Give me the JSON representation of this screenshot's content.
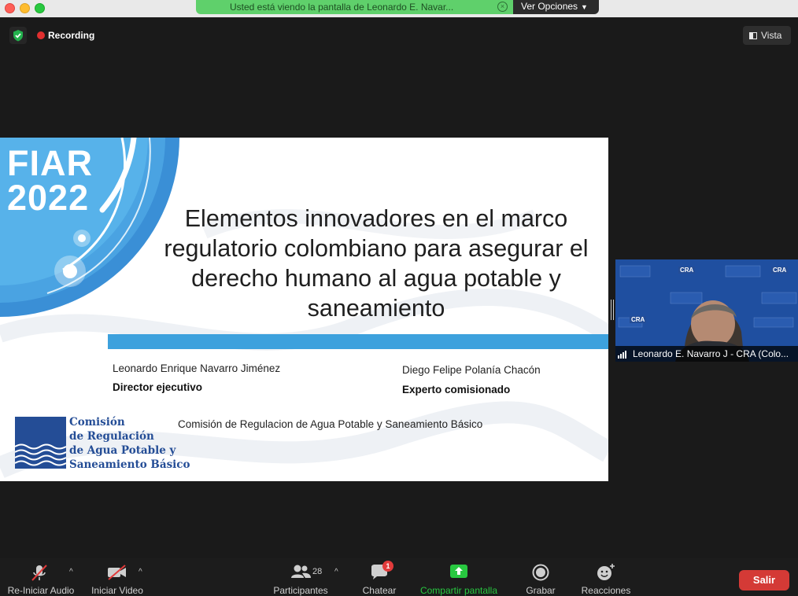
{
  "banner": {
    "text": "Usted está viendo la pantalla de Leonardo E. Navar...",
    "view_options": "Ver Opciones"
  },
  "recording": {
    "label": "Recording"
  },
  "view_button": {
    "label": "Vista"
  },
  "slide": {
    "fiar_line1": "FIAR",
    "fiar_line2": "2022",
    "title": "Elementos innovadores en el marco regulatorio colombiano para asegurar el derecho humano al agua potable y saneamiento",
    "presenter1_name": "Leonardo Enrique Navarro Jiménez",
    "presenter1_role": "Director ejecutivo",
    "presenter2_name": "Diego Felipe Polanía Chacón",
    "presenter2_role": "Experto comisionado",
    "organization": "Comisión de Regulacion de Agua Potable y Saneamiento Básico",
    "logo_line1": "Comisión",
    "logo_line2": "de Regulación",
    "logo_line3": "de Agua Potable y",
    "logo_line4": "Saneamiento Básico"
  },
  "speaker": {
    "name": "Leonardo E. Navarro J - CRA (Colo...",
    "backdrop_text": "CRA"
  },
  "toolbar": {
    "audio": "Re-Iniciar Audio",
    "video": "Iniciar Video",
    "participants": "Participantes",
    "participants_count": "28",
    "chat": "Chatear",
    "chat_badge": "1",
    "share": "Compartir pantalla",
    "record": "Grabar",
    "reactions": "Reacciones",
    "leave": "Salir"
  },
  "colors": {
    "share_green": "#28c840",
    "banner_green": "#5fd06b",
    "slide_blue": "#3da1dd",
    "cra_navy": "#244d96",
    "leave_red": "#d43a36"
  }
}
